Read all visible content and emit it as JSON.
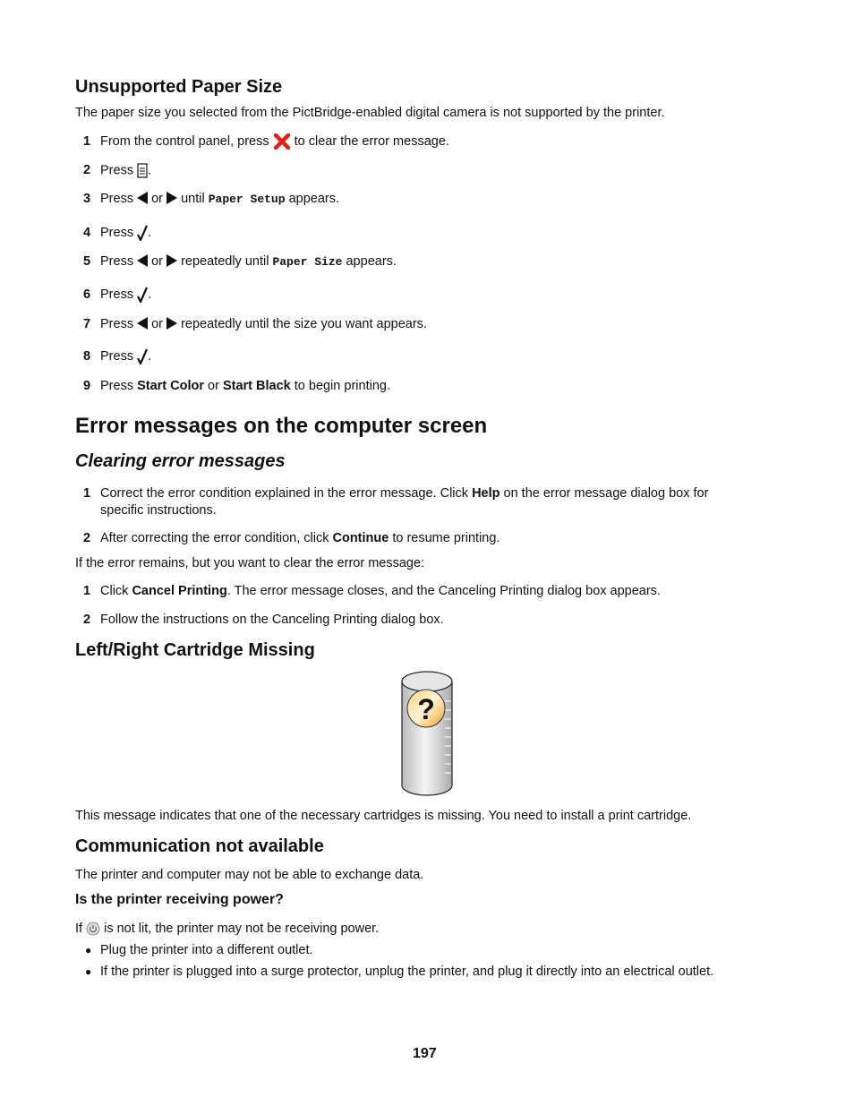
{
  "section1": {
    "title": "Unsupported Paper Size",
    "intro": "The paper size you selected from the PictBridge-enabled digital camera is not supported by the printer.",
    "steps": [
      {
        "n": "1",
        "a": "From the control panel, press ",
        "b": " to clear the error message."
      },
      {
        "n": "2",
        "a": "Press ",
        "b": "."
      },
      {
        "n": "3",
        "a": "Press ",
        "or": " or ",
        "c": " until ",
        "code": "Paper Setup",
        "d": " appears."
      },
      {
        "n": "4",
        "a": "Press ",
        "b": "."
      },
      {
        "n": "5",
        "a": "Press ",
        "or": " or ",
        "c": " repeatedly until ",
        "code": "Paper Size",
        "d": " appears."
      },
      {
        "n": "6",
        "a": "Press ",
        "b": "."
      },
      {
        "n": "7",
        "a": "Press ",
        "or": " or ",
        "c": " repeatedly until the size you want appears."
      },
      {
        "n": "8",
        "a": "Press ",
        "b": "."
      },
      {
        "n": "9",
        "a": "Press ",
        "bold1": "Start Color",
        "or": " or ",
        "bold2": "Start Black",
        "c": " to begin printing."
      }
    ]
  },
  "section2": {
    "title": "Error messages on the computer screen",
    "subtitle": "Clearing error messages",
    "steps": [
      {
        "n": "1",
        "a": "Correct the error condition explained in the error message. Click ",
        "bold": "Help",
        "b": " on the error message dialog box for",
        "c": "specific instructions."
      },
      {
        "n": "2",
        "a": "After correcting the error condition, click ",
        "bold": "Continue",
        "b": " to resume printing."
      }
    ],
    "middle": "If the error remains, but you want to clear the error message:",
    "steps2": [
      {
        "n": "1",
        "a": "Click ",
        "bold": "Cancel Printing",
        "b": ". The error message closes, and the Canceling Printing dialog box appears."
      },
      {
        "n": "2",
        "a": "Follow the instructions on the Canceling Printing dialog box."
      }
    ]
  },
  "section3": {
    "title": "Left/Right Cartridge Missing",
    "body": "This message indicates that one of the necessary cartridges is missing. You need to install a print cartridge."
  },
  "section4": {
    "title": "Communication not available",
    "body": "The printer and computer may not be able to exchange data.",
    "subhead": "Is the printer receiving power?",
    "power_a": "If ",
    "power_b": " is not lit, the printer may not be receiving power.",
    "bullets": [
      "Plug the printer into a different outlet.",
      "If the printer is plugged into a surge protector, unplug the printer, and plug it directly into an electrical outlet."
    ]
  },
  "page_number": "197",
  "icons": {
    "cancel": "cancel-x-icon",
    "menu": "menu-icon",
    "left": "left-arrow-icon",
    "right": "right-arrow-icon",
    "select": "checkmark-icon",
    "power": "power-icon",
    "cartridge": "cartridge-question-icon"
  },
  "colors": {
    "cancel_x": "#e0201b",
    "question_badge": "#f5a623"
  }
}
